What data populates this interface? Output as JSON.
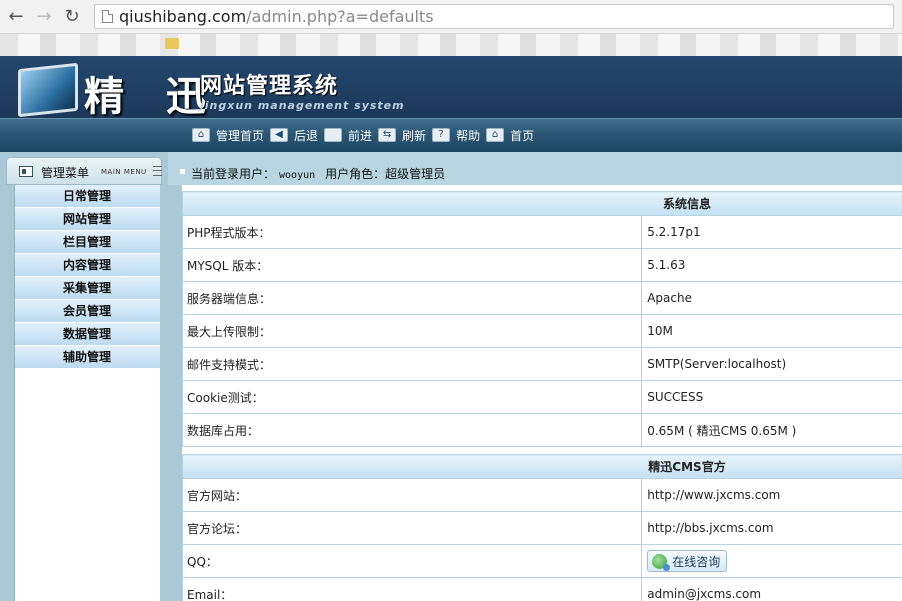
{
  "browser": {
    "url_host": "qiushibang.com",
    "url_path": "/admin.php?a=defaults",
    "back_icon": "arrow-left-icon",
    "forward_icon": "arrow-right-icon",
    "reload_icon": "reload-icon"
  },
  "header": {
    "logo_title": "精 迅",
    "logo_system": "网站管理系统",
    "logo_subtitle": "jingxun management system",
    "nav": [
      {
        "label": "管理首页",
        "icon": "home-icon"
      },
      {
        "label": "后退",
        "icon": "back-icon"
      },
      {
        "label": "前进",
        "icon": "forward-icon"
      },
      {
        "label": "刷新",
        "icon": "refresh-icon"
      },
      {
        "label": "帮助",
        "icon": "help-icon"
      },
      {
        "label": "首页",
        "icon": "home-icon"
      }
    ]
  },
  "sidebar": {
    "title": "管理菜单",
    "subtitle": "MAIN MENU",
    "items": [
      {
        "label": "日常管理"
      },
      {
        "label": "网站管理"
      },
      {
        "label": "栏目管理"
      },
      {
        "label": "内容管理"
      },
      {
        "label": "采集管理"
      },
      {
        "label": "会员管理"
      },
      {
        "label": "数据管理"
      },
      {
        "label": "辅助管理"
      }
    ]
  },
  "userbar": {
    "user_label": "当前登录用户：",
    "user_name": "wooyun",
    "role_label": "用户角色：",
    "role_value": "超级管理员"
  },
  "system_info": {
    "title": "系统信息",
    "rows": [
      {
        "label": "PHP程式版本：",
        "value": "5.2.17p1"
      },
      {
        "label": "MYSQL 版本：",
        "value": "5.1.63"
      },
      {
        "label": "服务器端信息：",
        "value": "Apache"
      },
      {
        "label": "最大上传限制：",
        "value": "10M"
      },
      {
        "label": "邮件支持模式：",
        "value": "SMTP(Server:localhost)"
      },
      {
        "label": "Cookie测试：",
        "value": "SUCCESS"
      },
      {
        "label": "数据库占用：",
        "value": "0.65M ( 精迅CMS 0.65M )"
      }
    ]
  },
  "official": {
    "title": "精迅CMS官方",
    "rows": [
      {
        "label": "官方网站：",
        "value": "http://www.jxcms.com"
      },
      {
        "label": "官方论坛：",
        "value": "http://bbs.jxcms.com"
      },
      {
        "label": "QQ：",
        "button": "在线咨询"
      },
      {
        "label": "Email：",
        "value": "admin@jxcms.com"
      }
    ]
  }
}
